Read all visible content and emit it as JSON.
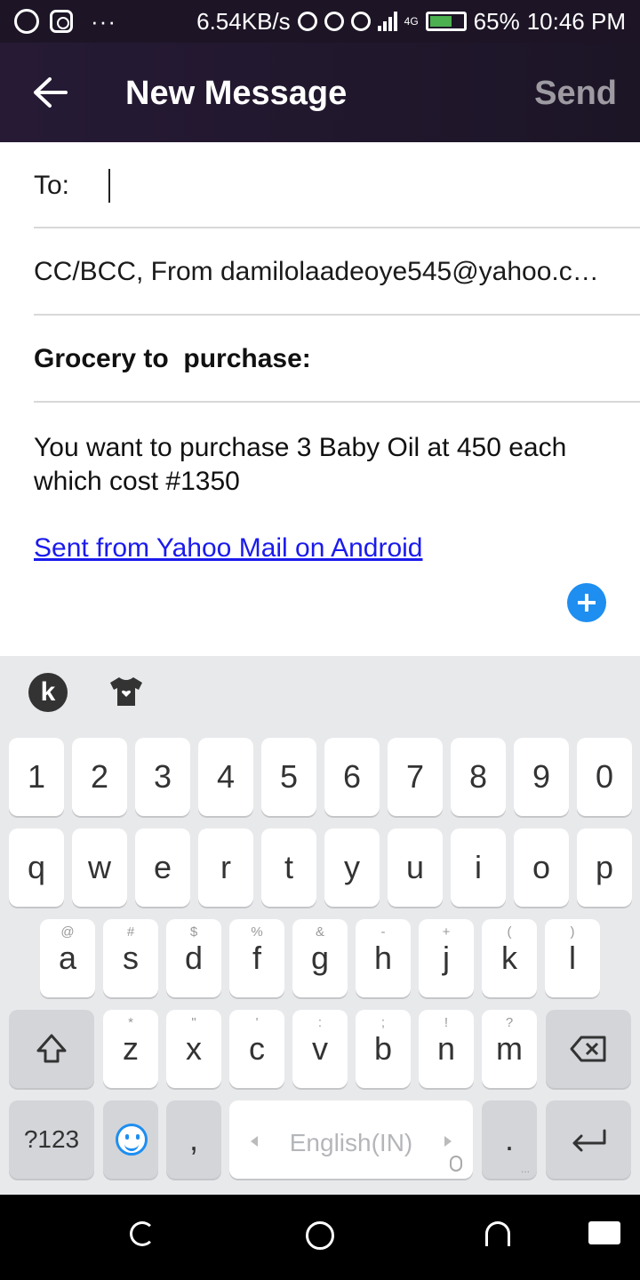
{
  "status_bar": {
    "network_speed": "6.54KB/s",
    "network_type": "4G",
    "battery": "65%",
    "time": "10:46 PM",
    "more": "···"
  },
  "header": {
    "title": "New Message",
    "send_label": "Send"
  },
  "compose": {
    "to_label": "To:",
    "cc_line": "CC/BCC, From damilolaadeoye545@yahoo.c…",
    "subject": "Grocery to  purchase:",
    "body": "You want to purchase 3 Baby Oil at 450 each which cost #1350",
    "signature": "Sent from Yahoo Mail on Android"
  },
  "keyboard": {
    "number_row": [
      "1",
      "2",
      "3",
      "4",
      "5",
      "6",
      "7",
      "8",
      "9",
      "0"
    ],
    "row1": [
      "q",
      "w",
      "e",
      "r",
      "t",
      "y",
      "u",
      "i",
      "o",
      "p"
    ],
    "row2": [
      "a",
      "s",
      "d",
      "f",
      "g",
      "h",
      "j",
      "k",
      "l"
    ],
    "row2_hints": [
      "@",
      "#",
      "$",
      "%",
      "&",
      "-",
      "+",
      "(",
      ")"
    ],
    "row3": [
      "z",
      "x",
      "c",
      "v",
      "b",
      "n",
      "m"
    ],
    "row3_hints": [
      "*",
      "\"",
      "'",
      ":",
      ";",
      "!",
      "?"
    ],
    "symbols_label": "?123",
    "comma": ",",
    "space_label": "English(IN)",
    "period": ".",
    "period_sub": "..."
  },
  "colors": {
    "header_bg": "#221830",
    "accent": "#1e8ef0",
    "link": "#1a1aee"
  }
}
